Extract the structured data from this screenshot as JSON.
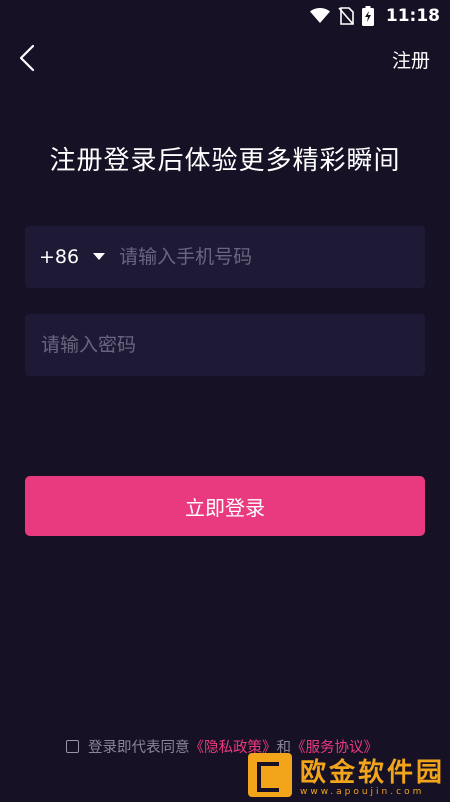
{
  "status_bar": {
    "time": "11:18",
    "icons": [
      "wifi-icon",
      "no-sim-icon",
      "battery-charging-icon"
    ]
  },
  "nav": {
    "back_icon": "chevron-left-icon",
    "register_label": "注册"
  },
  "title": "注册登录后体验更多精彩瞬间",
  "phone": {
    "country_code": "+86",
    "placeholder": "请输入手机号码",
    "value": ""
  },
  "password": {
    "placeholder": "请输入密码",
    "value": ""
  },
  "login_button": "立即登录",
  "agreement": {
    "prefix": "登录即代表同意",
    "privacy_link": "《隐私政策》",
    "conjunction": "和",
    "terms_link": "《服务协议》",
    "checked": false
  },
  "watermark": {
    "title": "欧金软件园",
    "url": "www.apoujin.com"
  },
  "colors": {
    "background": "#161125",
    "field_background": "#1e1934",
    "accent": "#e93a7f",
    "watermark": "#f2a51a"
  }
}
